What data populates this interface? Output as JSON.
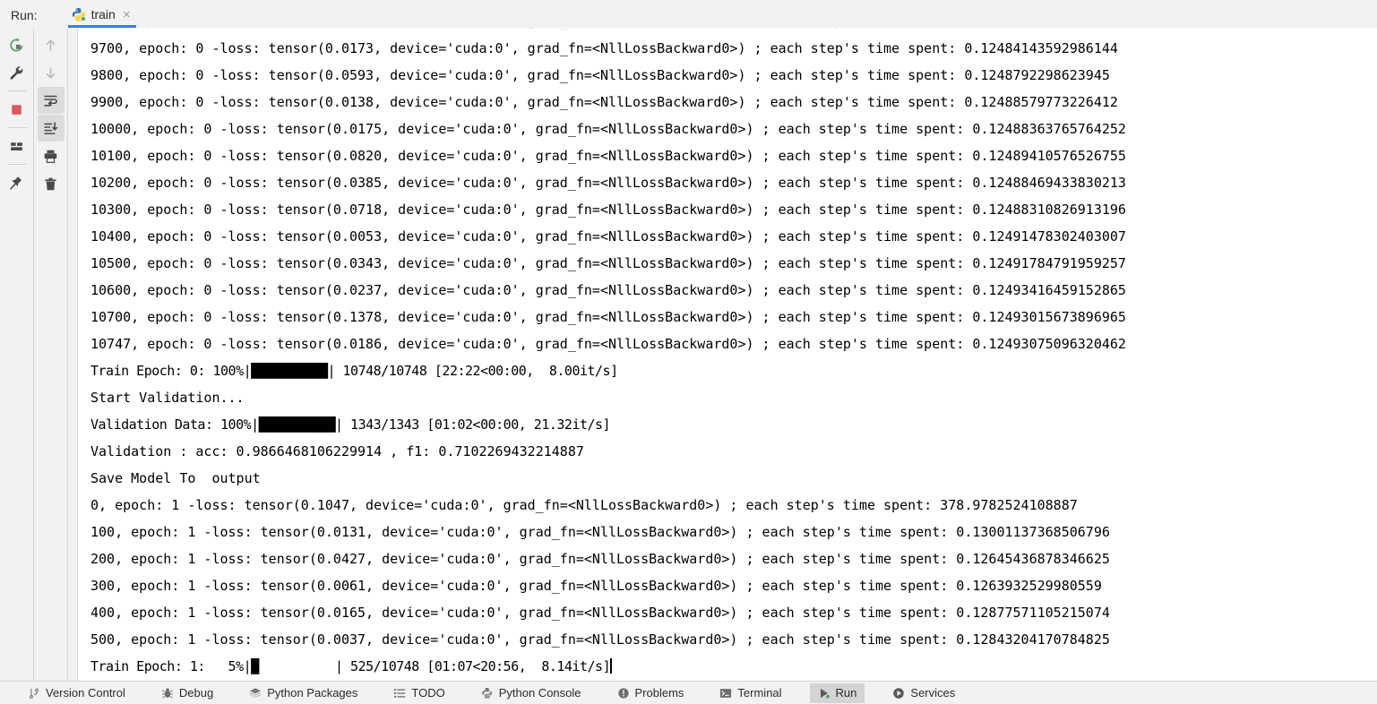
{
  "window": {
    "run_label": "Run:",
    "accent_color": "#3b7dd8",
    "console_bg": "#ffffff",
    "chrome_bg": "#f2f2f2"
  },
  "tab": {
    "title": "train",
    "icon": "python-icon",
    "close_glyph": "×",
    "running": true
  },
  "left_toolbar": {
    "buttons": [
      {
        "name": "rerun-button",
        "icon": "rerun-icon",
        "title": "Rerun"
      },
      {
        "name": "modify-run-configuration-button",
        "icon": "wrench-icon",
        "title": "Modify Run Configuration"
      },
      {
        "name": "stop-button",
        "icon": "stop-square-icon",
        "title": "Stop"
      },
      {
        "name": "layout-button",
        "icon": "layout-icon",
        "title": "Layout Settings"
      },
      {
        "name": "pin-tab-button",
        "icon": "pin-icon",
        "title": "Pin Tab"
      }
    ]
  },
  "right_toolbar": {
    "buttons": [
      {
        "name": "previous-occurrence-button",
        "icon": "arrow-up-icon",
        "title": "Up",
        "active": false
      },
      {
        "name": "next-occurrence-button",
        "icon": "arrow-down-icon",
        "title": "Down",
        "active": false
      },
      {
        "name": "soft-wrap-button",
        "icon": "soft-wrap-icon",
        "title": "Soft-Wrap",
        "active": true
      },
      {
        "name": "scroll-to-end-button",
        "icon": "scroll-to-end-icon",
        "title": "Scroll to End",
        "active": true
      },
      {
        "name": "print-button",
        "icon": "printer-icon",
        "title": "Print",
        "active": false
      },
      {
        "name": "clear-all-button",
        "icon": "trash-icon",
        "title": "Clear All",
        "active": false
      }
    ]
  },
  "console": {
    "lines": [
      "9700, epoch: 0 -loss: tensor(0.0173, device='cuda:0', grad_fn=<NllLossBackward0>) ; each step's time spent: 0.12484143592986144",
      "9800, epoch: 0 -loss: tensor(0.0593, device='cuda:0', grad_fn=<NllLossBackward0>) ; each step's time spent: 0.1248792298623945",
      "9900, epoch: 0 -loss: tensor(0.0138, device='cuda:0', grad_fn=<NllLossBackward0>) ; each step's time spent: 0.12488579773226412",
      "10000, epoch: 0 -loss: tensor(0.0175, device='cuda:0', grad_fn=<NllLossBackward0>) ; each step's time spent: 0.12488363765764252",
      "10100, epoch: 0 -loss: tensor(0.0820, device='cuda:0', grad_fn=<NllLossBackward0>) ; each step's time spent: 0.12489410576526755",
      "10200, epoch: 0 -loss: tensor(0.0385, device='cuda:0', grad_fn=<NllLossBackward0>) ; each step's time spent: 0.12488469433830213",
      "10300, epoch: 0 -loss: tensor(0.0718, device='cuda:0', grad_fn=<NllLossBackward0>) ; each step's time spent: 0.12488310826913196",
      "10400, epoch: 0 -loss: tensor(0.0053, device='cuda:0', grad_fn=<NllLossBackward0>) ; each step's time spent: 0.12491478302403007",
      "10500, epoch: 0 -loss: tensor(0.0343, device='cuda:0', grad_fn=<NllLossBackward0>) ; each step's time spent: 0.12491784791959257",
      "10600, epoch: 0 -loss: tensor(0.0237, device='cuda:0', grad_fn=<NllLossBackward0>) ; each step's time spent: 0.12493416459152865",
      "10700, epoch: 0 -loss: tensor(0.1378, device='cuda:0', grad_fn=<NllLossBackward0>) ; each step's time spent: 0.12493015673896965",
      "10747, epoch: 0 -loss: tensor(0.0186, device='cuda:0', grad_fn=<NllLossBackward0>) ; each step's time spent: 0.12493075096320462",
      "Train Epoch: 0: 100%|██████████| 10748/10748 [22:22<00:00,  8.00it/s]",
      "Start Validation...",
      "Validation Data: 100%|██████████| 1343/1343 [01:02<00:00, 21.32it/s]",
      "Validation : acc: 0.9866468106229914 , f1: 0.7102269432214887",
      "Save Model To  output",
      "0, epoch: 1 -loss: tensor(0.1047, device='cuda:0', grad_fn=<NllLossBackward0>) ; each step's time spent: 378.9782524108887",
      "100, epoch: 1 -loss: tensor(0.0131, device='cuda:0', grad_fn=<NllLossBackward0>) ; each step's time spent: 0.13001137368506796",
      "200, epoch: 1 -loss: tensor(0.0427, device='cuda:0', grad_fn=<NllLossBackward0>) ; each step's time spent: 0.12645436878346625",
      "300, epoch: 1 -loss: tensor(0.0061, device='cuda:0', grad_fn=<NllLossBackward0>) ; each step's time spent: 0.1263932529980559",
      "400, epoch: 1 -loss: tensor(0.0165, device='cuda:0', grad_fn=<NllLossBackward0>) ; each step's time spent: 0.12877571105215074",
      "500, epoch: 1 -loss: tensor(0.0037, device='cuda:0', grad_fn=<NllLossBackward0>) ; each step's time spent: 0.12843204170784825"
    ],
    "last_line_prefix": "Train Epoch: 1:   5%|",
    "last_line_bar": "█",
    "last_line_suffix": "          | 525/10748 [01:07<20:56,  8.14it/s]",
    "progress": {
      "train_epoch_0": {
        "label": "Train Epoch: 0",
        "percent": 100,
        "current": 10748,
        "total": 10748,
        "elapsed": "22:22",
        "remaining": "00:00",
        "rate": "8.00it/s"
      },
      "validation": {
        "label": "Validation Data",
        "percent": 100,
        "current": 1343,
        "total": 1343,
        "elapsed": "01:02",
        "remaining": "00:00",
        "rate": "21.32it/s"
      },
      "train_epoch_1": {
        "label": "Train Epoch: 1",
        "percent": 5,
        "current": 525,
        "total": 10748,
        "elapsed": "01:07",
        "remaining": "20:56",
        "rate": "8.14it/s"
      }
    },
    "metrics": {
      "accuracy": "0.9866468106229914",
      "f1": "0.7102269432214887",
      "save_path": "output"
    }
  },
  "statusbar": {
    "items": [
      {
        "label": "Version Control",
        "icon": "branch-icon",
        "active": false,
        "name": "status-version-control"
      },
      {
        "label": "Debug",
        "icon": "bug-icon",
        "active": false,
        "name": "status-debug"
      },
      {
        "label": "Python Packages",
        "icon": "packages-icon",
        "active": false,
        "name": "status-python-packages"
      },
      {
        "label": "TODO",
        "icon": "todo-list-icon",
        "active": false,
        "name": "status-todo"
      },
      {
        "label": "Python Console",
        "icon": "python-console-icon",
        "active": false,
        "name": "status-python-console"
      },
      {
        "label": "Problems",
        "icon": "problems-icon",
        "active": false,
        "name": "status-problems"
      },
      {
        "label": "Terminal",
        "icon": "terminal-icon",
        "active": false,
        "name": "status-terminal"
      },
      {
        "label": "Run",
        "icon": "run-play-icon",
        "active": true,
        "name": "status-run"
      },
      {
        "label": "Services",
        "icon": "services-icon",
        "active": false,
        "name": "status-services"
      }
    ]
  }
}
